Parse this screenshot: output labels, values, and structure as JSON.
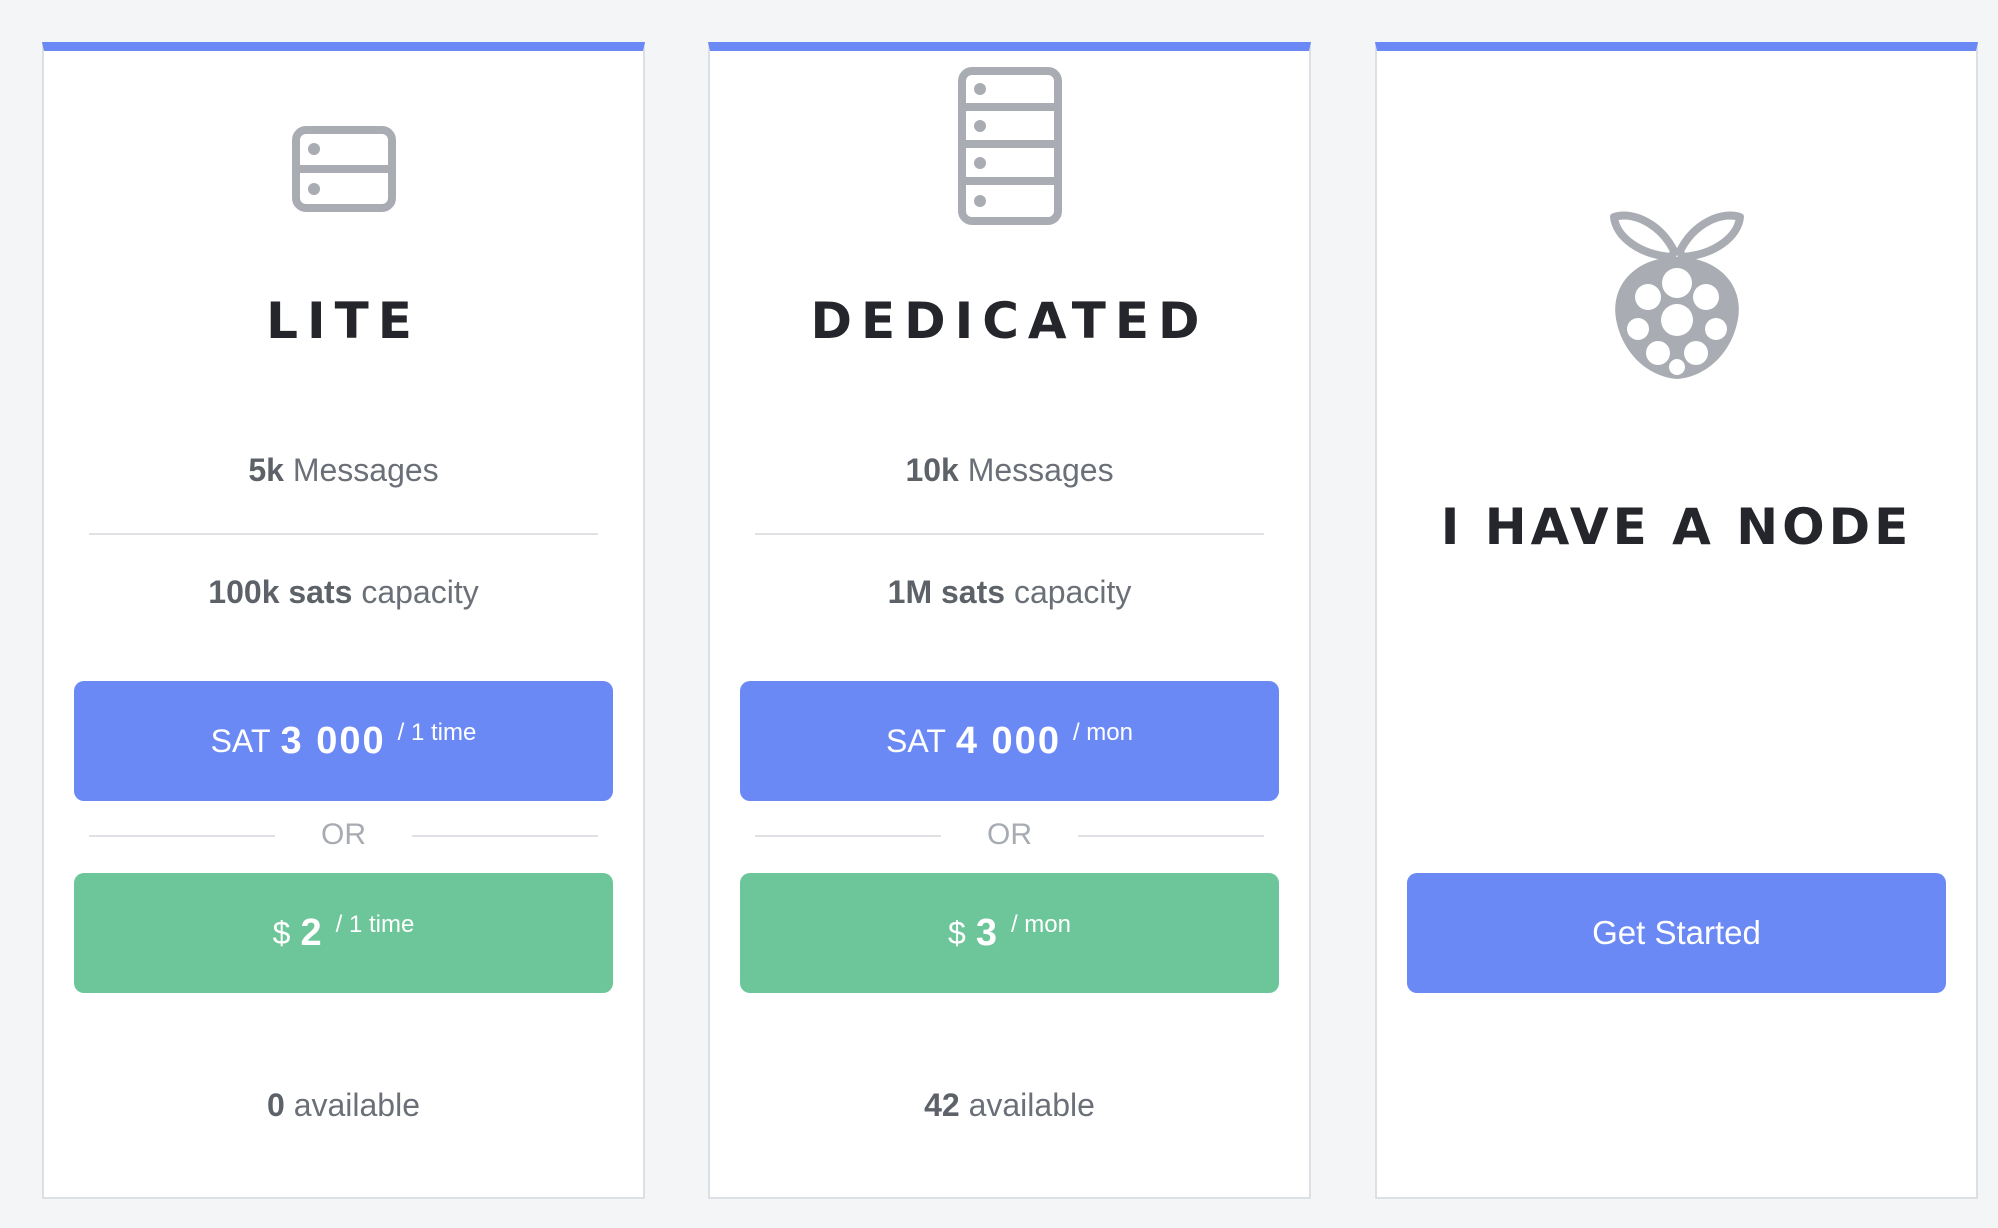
{
  "colors": {
    "accent": "#6b89f5",
    "green": "#6dc69a",
    "title": "#24262b",
    "muted_text": "#6b7078",
    "icon_gray": "#a9adb3"
  },
  "plans": {
    "lite": {
      "icon": "server-icon",
      "title": "LITE",
      "messages": {
        "value": "5k",
        "label": "Messages"
      },
      "capacity": {
        "value": "100k sats",
        "label": "capacity"
      },
      "sat_price": {
        "currency": "SAT",
        "amount": "3 000",
        "period": "/ 1 time"
      },
      "or_label": "OR",
      "usd_price": {
        "currency": "$",
        "amount": "2",
        "period": "/ 1 time"
      },
      "available": {
        "count": "0",
        "label": "available"
      }
    },
    "dedicated": {
      "icon": "server-rack-icon",
      "title": "DEDICATED",
      "messages": {
        "value": "10k",
        "label": "Messages"
      },
      "capacity": {
        "value": "1M sats",
        "label": "capacity"
      },
      "sat_price": {
        "currency": "SAT",
        "amount": "4 000",
        "period": "/ mon"
      },
      "or_label": "OR",
      "usd_price": {
        "currency": "$",
        "amount": "3",
        "period": "/ mon"
      },
      "available": {
        "count": "42",
        "label": "available"
      }
    },
    "node": {
      "icon": "raspberry-pi-icon",
      "title": "I HAVE A NODE",
      "cta_label": "Get Started"
    }
  }
}
